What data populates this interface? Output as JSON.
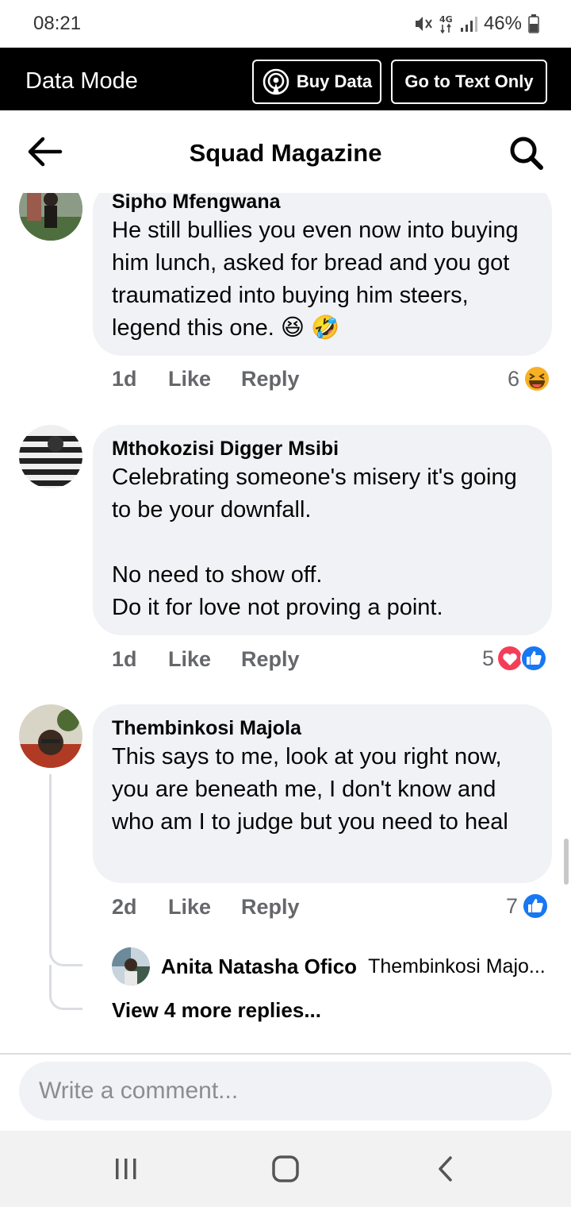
{
  "status_bar": {
    "time": "08:21",
    "battery": "46%",
    "network": "4G"
  },
  "data_mode": {
    "title": "Data Mode",
    "buy_data": "Buy Data",
    "text_only": "Go to Text Only"
  },
  "header": {
    "title": "Squad Magazine"
  },
  "comments": [
    {
      "author": "Sipho Mfengwana",
      "text": "He still bullies you even now into buying him lunch, asked for bread and you got traumatized into buying him steers, legend this one. 😆 🤣",
      "time": "1d",
      "like": "Like",
      "reply": "Reply",
      "reaction_count": "6",
      "reactions": [
        "haha-icon"
      ]
    },
    {
      "author": "Mthokozisi Digger Msibi",
      "text": "Celebrating someone's misery it's going to be your downfall.\n\nNo need to show off.\nDo it for love not proving a point.",
      "time": "1d",
      "like": "Like",
      "reply": "Reply",
      "reaction_count": "5",
      "reactions": [
        "love-icon",
        "like-icon"
      ]
    },
    {
      "author": "Thembinkosi Majola",
      "text": "This says to me, look at you right now, you are beneath me, I don't know and who am I to judge but you need to heal",
      "time": "2d",
      "like": "Like",
      "reply": "Reply",
      "reaction_count": "7",
      "reactions": [
        "like-icon"
      ],
      "reply_preview": {
        "author": "Anita Natasha Ofico",
        "text": "Thembinkosi Majo..."
      },
      "more_replies": "View 4 more replies..."
    }
  ],
  "composer": {
    "placeholder": "Write a comment..."
  },
  "colors": {
    "like_blue": "#1877f2",
    "love_red": "#f33e58",
    "haha_yellow": "#f7b125",
    "bubble": "#f0f2f5",
    "meta_gray": "#65676b"
  }
}
